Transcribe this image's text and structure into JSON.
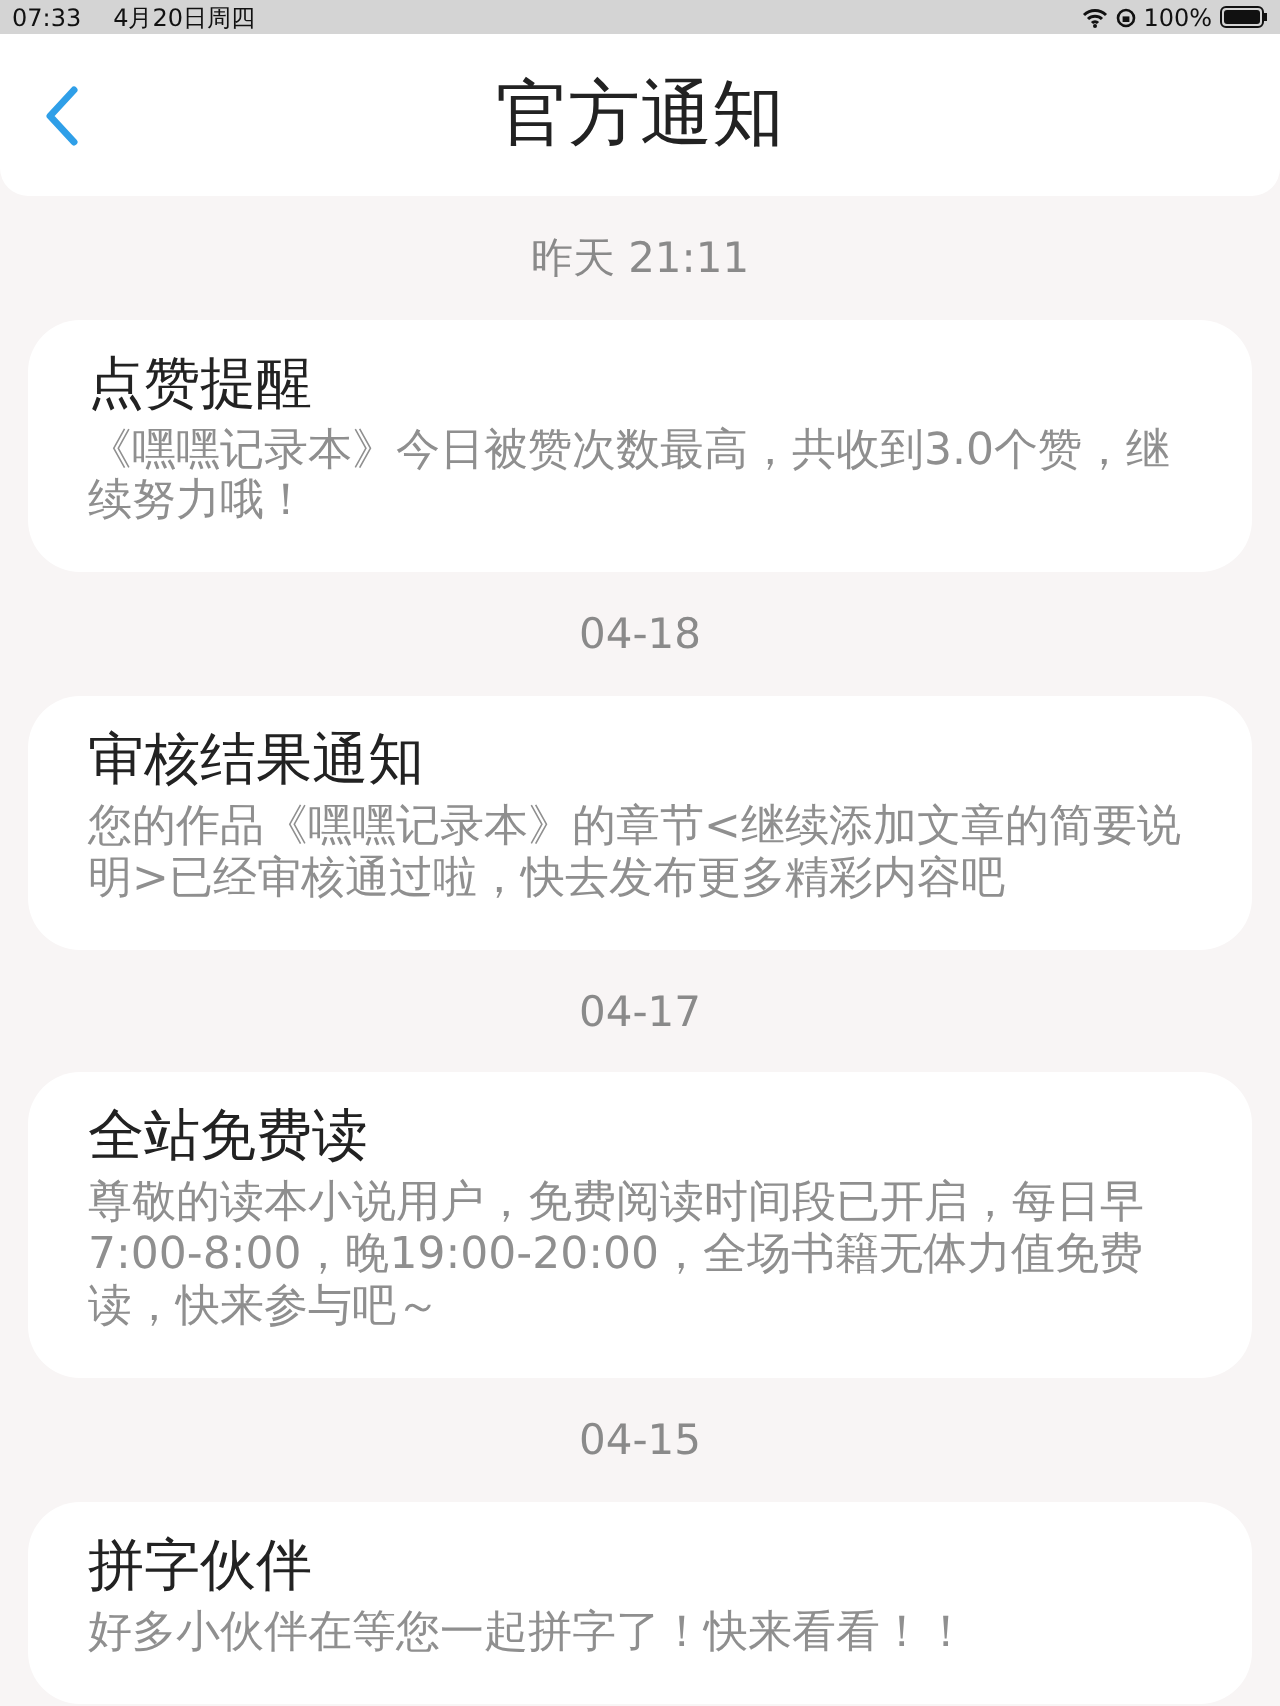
{
  "status_bar": {
    "time": "07:33",
    "date": "4月20日周四",
    "battery": "100%"
  },
  "header": {
    "title": "官方通知"
  },
  "messages": [
    {
      "time": "昨天 21:11",
      "title": "点赞提醒",
      "body": "《嘿嘿记录本》今日被赞次数最高，共收到3.0个赞，继续努力哦！"
    },
    {
      "time": "04-18",
      "title": "审核结果通知",
      "body": "您的作品《嘿嘿记录本》的章节<继续添加文章的简要说明>已经审核通过啦，快去发布更多精彩内容吧"
    },
    {
      "time": "04-17",
      "title": "全站免费读",
      "body": "尊敬的读本小说用户，免费阅读时间段已开启，每日早7:00-8:00，晚19:00-20:00，全场书籍无体力值免费读，快来参与吧～"
    },
    {
      "time": "04-15",
      "title": "拼字伙伴",
      "body": "好多小伙伴在等您一起拼字了！快来看看！！"
    }
  ]
}
